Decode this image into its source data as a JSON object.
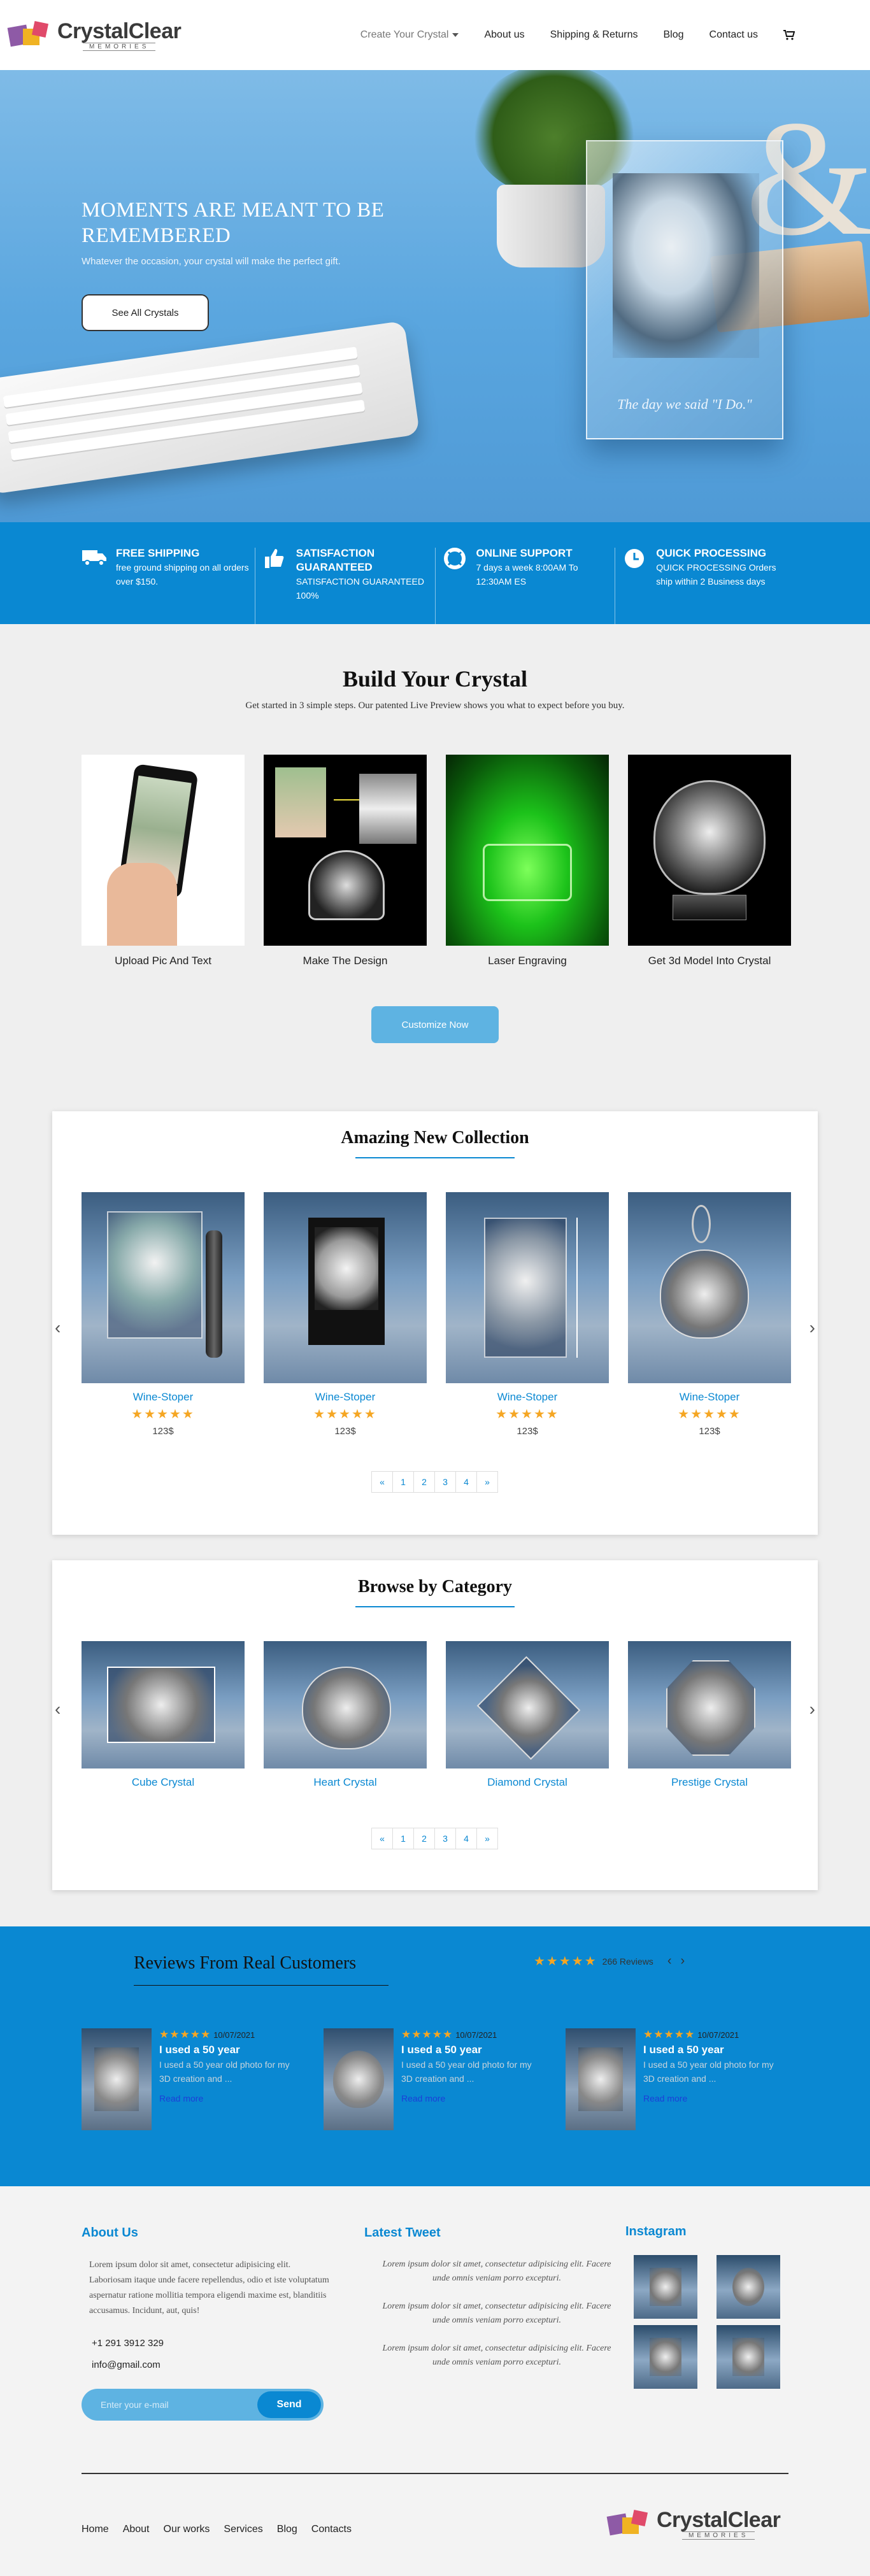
{
  "header": {
    "logo_word": "CrystalClear",
    "logo_sub": "MEMORIES",
    "nav": [
      "Create Your Crystal",
      "About us",
      "Shipping & Returns",
      "Blog",
      "Contact us"
    ]
  },
  "hero": {
    "title": "MOMENTS ARE MEANT TO BE REMEMBERED",
    "subtitle": "Whatever the occasion, your crystal will make the perfect gift.",
    "button": "See All Crystals",
    "crystal_caption": "The day we said \"I Do.\""
  },
  "features": [
    {
      "title": "FREE SHIPPING",
      "text": "free ground shipping on all orders over $150.",
      "icon": "truck-icon"
    },
    {
      "title": "SATISFACTION GUARANTEED",
      "text": "SATISFACTION GUARANTEED 100%",
      "icon": "thumbs-up-icon"
    },
    {
      "title": "ONLINE SUPPORT",
      "text": "7 days a week 8:00AM To 12:30AM ES",
      "icon": "lifebuoy-icon"
    },
    {
      "title": "QUICK PROCESSING",
      "text": "QUICK PROCESSING Orders ship within 2 Business days",
      "icon": "clock-icon"
    }
  ],
  "build": {
    "title": "Build Your Crystal",
    "subtitle": "Get started in 3 simple steps. Our patented Live Preview shows you what to expect before you buy.",
    "steps": [
      "Upload Pic And Text",
      "Make The Design",
      "Laser Engraving",
      "Get 3d Model Into Crystal"
    ],
    "button": "Customize Now"
  },
  "collection": {
    "title": "Amazing New Collection",
    "items": [
      {
        "name": "Wine-Stoper",
        "price": "123$",
        "rating": 5
      },
      {
        "name": "Wine-Stoper",
        "price": "123$",
        "rating": 5
      },
      {
        "name": "Wine-Stoper",
        "price": "123$",
        "rating": 5
      },
      {
        "name": "Wine-Stoper",
        "price": "123$",
        "rating": 5
      }
    ],
    "pager": [
      "«",
      "1",
      "2",
      "3",
      "4",
      "»"
    ]
  },
  "categories": {
    "title": "Browse by Category",
    "items": [
      "Cube Crystal",
      "Heart Crystal",
      "Diamond Crystal",
      "Prestige Crystal"
    ],
    "pager": [
      "«",
      "1",
      "2",
      "3",
      "4",
      "»"
    ]
  },
  "reviews": {
    "title": "Reviews From Real Customers",
    "summary": "266 Reviews",
    "items": [
      {
        "date": "10/07/2021",
        "title": "I used a 50 year",
        "text": "I used a 50 year old photo for my 3D creation and ...",
        "more": "Read more",
        "rating": 5
      },
      {
        "date": "10/07/2021",
        "title": "I used a 50 year",
        "text": "I used a 50 year old photo for my 3D creation and ...",
        "more": "Read more",
        "rating": 5
      },
      {
        "date": "10/07/2021",
        "title": "I used a 50 year",
        "text": "I used a 50 year old photo for my 3D creation and ...",
        "more": "Read more",
        "rating": 5
      }
    ]
  },
  "footer": {
    "about_title": "About Us",
    "about_text": "Lorem ipsum dolor sit amet, consectetur adipisicing elit. Laboriosam itaque unde facere repellendus, odio et iste voluptatum aspernatur ratione mollitia tempora eligendi maxime est, blanditiis accusamus. Incidunt, aut, quis!",
    "phone": "+1 291 3912 329",
    "email": "info@gmail.com",
    "subscribe_placeholder": "Enter your e-mail",
    "subscribe_button": "Send",
    "tweet_title": "Latest Tweet",
    "tweets": [
      "Lorem ipsum dolor sit amet, consectetur adipisicing elit. Facere unde omnis veniam porro excepturi.",
      "Lorem ipsum dolor sit amet, consectetur adipisicing elit. Facere unde omnis veniam porro excepturi.",
      "Lorem ipsum dolor sit amet, consectetur adipisicing elit. Facere unde omnis veniam porro excepturi."
    ],
    "instagram_title": "Instagram",
    "links": [
      "Home",
      "About",
      "Our works",
      "Services",
      "Blog",
      "Contacts"
    ]
  },
  "colors": {
    "primary": "#0a88d2",
    "accent": "#5eb3e2",
    "star": "#f5a623"
  }
}
